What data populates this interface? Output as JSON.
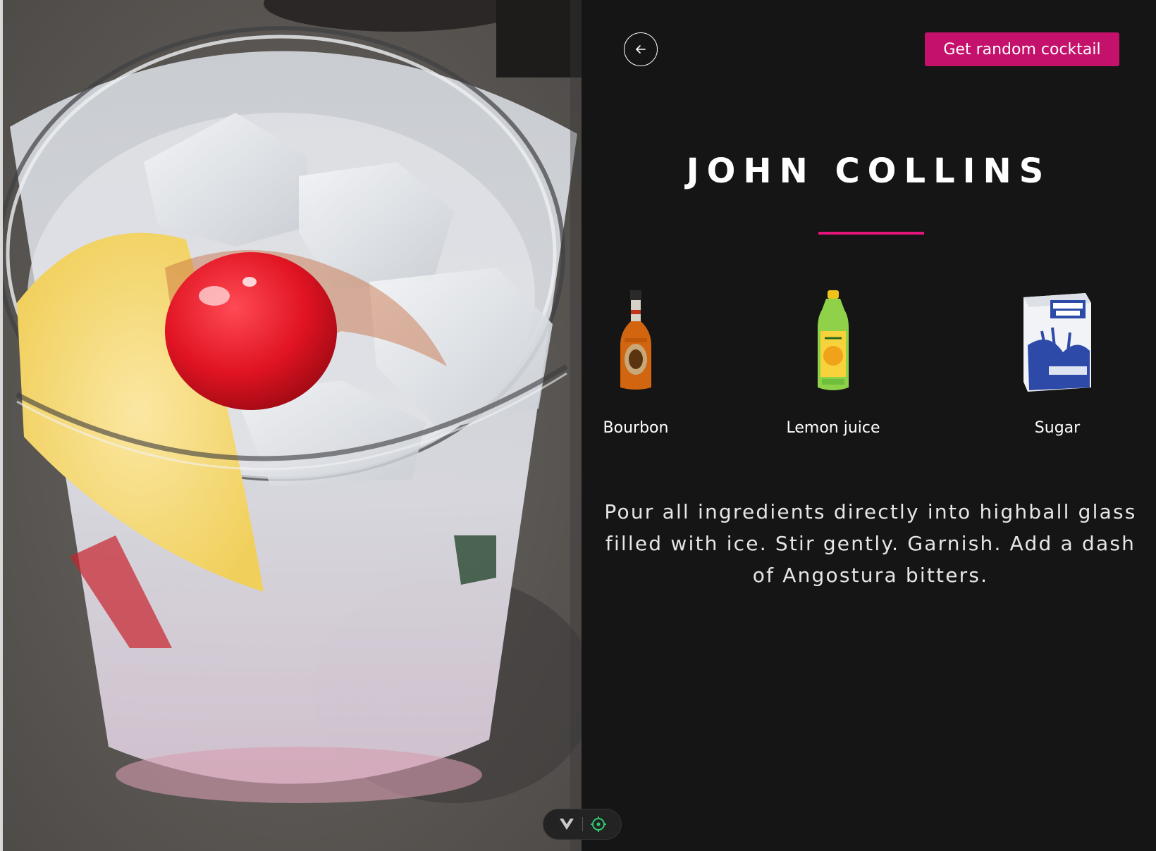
{
  "header": {
    "back_icon": "arrow-left-icon",
    "random_button_label": "Get random cocktail"
  },
  "cocktail": {
    "name": "JOHN COLLINS",
    "ingredients": [
      {
        "label": "Bourbon",
        "icon": "bourbon-bottle"
      },
      {
        "label": "Lemon juice",
        "icon": "lemon-juice-bottle"
      },
      {
        "label": "Sugar",
        "icon": "sugar-bag"
      }
    ],
    "instructions": "Pour all ingredients directly into highball glass filled with ice. Stir gently. Garnish. Add a dash of Angostura bitters."
  },
  "toolbar": {
    "icons": [
      "vue-devtools-icon",
      "inspect-target-icon"
    ]
  },
  "colors": {
    "accent": "#c4126c",
    "divider": "#e3147a",
    "background": "#151515",
    "target_icon": "#2ecc71"
  }
}
